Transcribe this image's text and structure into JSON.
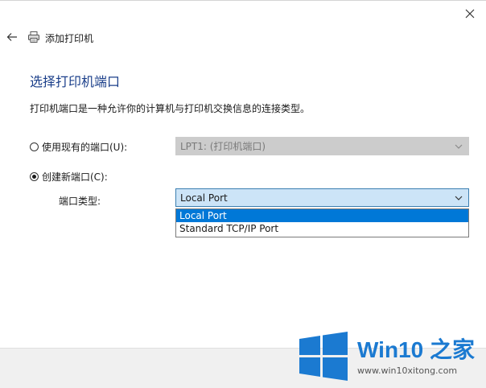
{
  "window": {
    "title": "添加打印机"
  },
  "page": {
    "heading": "选择打印机端口",
    "description": "打印机端口是一种允许你的计算机与打印机交换信息的连接类型。"
  },
  "options": {
    "existing_port": {
      "label": "使用现有的端口(U):",
      "selected_value": "LPT1: (打印机端口)",
      "checked": false
    },
    "new_port": {
      "label": "创建新端口(C):",
      "checked": true,
      "port_type_label": "端口类型:",
      "selected_value": "Local Port",
      "dropdown_options": [
        {
          "label": "Local Port",
          "highlighted": true
        },
        {
          "label": "Standard TCP/IP Port",
          "highlighted": false
        }
      ]
    }
  },
  "watermark": {
    "brand": "Win10 之家",
    "url": "www.win10xitong.com"
  },
  "colors": {
    "heading": "#1b3f8a",
    "highlight": "#0078d7",
    "select_active_bg": "#cce4f7",
    "select_active_border": "#3c7fb1",
    "select_disabled_bg": "#cccccc",
    "logo_blue": "#1b7ad1"
  },
  "icons": {
    "close": "close-icon",
    "back": "back-arrow-icon",
    "printer": "printer-icon",
    "chevron": "chevron-down-icon",
    "logo": "windows-logo-icon"
  }
}
